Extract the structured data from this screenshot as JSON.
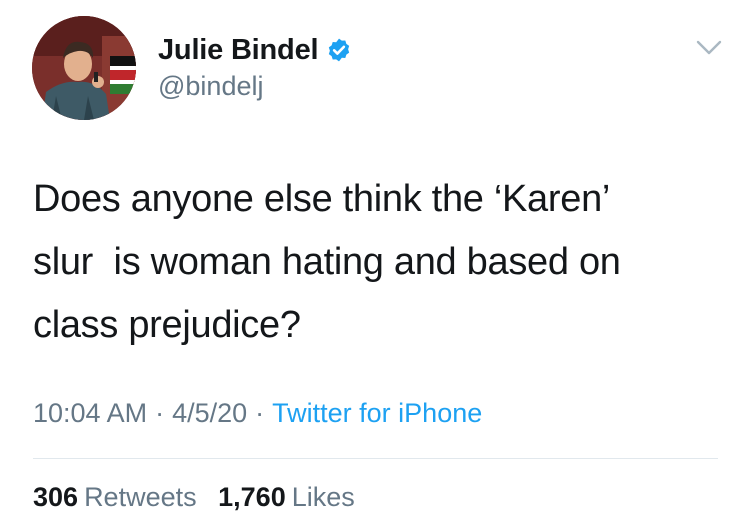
{
  "colors": {
    "text": "#14171a",
    "muted": "#657786",
    "link": "#1da1f2",
    "verified": "#1da1f2",
    "divider": "#e1e8ed"
  },
  "author": {
    "display_name": "Julie Bindel",
    "handle": "@bindelj",
    "verified_icon": "verified-badge-icon",
    "avatar_icon": "profile-photo"
  },
  "menu_icon": "chevron-down-icon",
  "tweet": {
    "text": "Does anyone else think the ‘Karen’\nslur  is woman hating and based on\nclass prejudice?"
  },
  "meta": {
    "time": "10:04 AM",
    "separator": "·",
    "date": "4/5/20",
    "source": "Twitter for iPhone"
  },
  "stats": {
    "retweets_count": "306",
    "retweets_label": "Retweets",
    "likes_count": "1,760",
    "likes_label": "Likes"
  }
}
